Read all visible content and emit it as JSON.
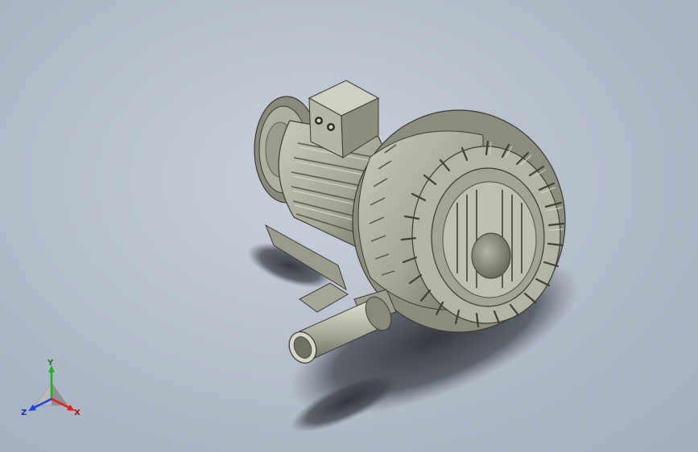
{
  "viewport": {
    "background_top": "#c8d0dc",
    "background_bottom": "#a3adbb"
  },
  "model": {
    "body_color": "#a9a99a",
    "shadow_color": "#3a3d44"
  },
  "triad": {
    "x_label": "X",
    "y_label": "Y",
    "z_label": "Z",
    "x_color": "#e02020",
    "y_color": "#20b020",
    "z_color": "#2040e0"
  }
}
